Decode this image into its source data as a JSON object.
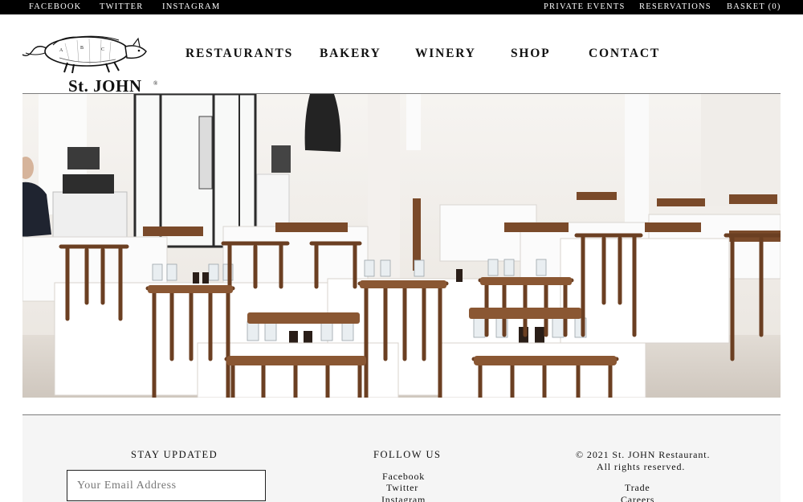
{
  "topbar": {
    "left_links": [
      "FACEBOOK",
      "TWITTER",
      "INSTAGRAM"
    ],
    "right_links": [
      "PRIVATE EVENTS",
      "RESERVATIONS",
      "BASKET (0)"
    ]
  },
  "brand": {
    "name": "St. JOHN",
    "mark": "®"
  },
  "nav": {
    "items": [
      "RESTAURANTS",
      "BAKERY",
      "WINERY",
      "SHOP",
      "CONTACT"
    ]
  },
  "hero": {
    "photo": "restaurant-dining-room",
    "colors": {
      "wall": "#f1eeea",
      "tablecloth": "#ffffff",
      "chair": "#6b3f22"
    }
  },
  "footer": {
    "stay_updated": {
      "title": "STAY UPDATED",
      "email_placeholder": "Your Email Address"
    },
    "follow_us": {
      "title": "FOLLOW US",
      "links": [
        "Facebook",
        "Twitter",
        "Instagram"
      ]
    },
    "legal": {
      "line1": "© 2021 St. JOHN Restaurant.",
      "line2": "All rights reserved.",
      "links": [
        "Trade",
        "Careers"
      ]
    }
  }
}
